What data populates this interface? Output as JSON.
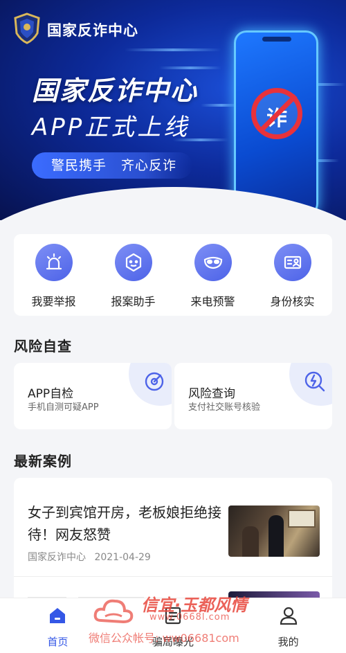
{
  "header": {
    "app_title": "国家反诈中心"
  },
  "banner": {
    "headline": "国家反诈中心",
    "subline": "APP正式上线",
    "slogan": "警民携手 齐心反诈",
    "sign_char": "诈"
  },
  "quick_actions": [
    {
      "label": "我要举报",
      "icon": "alarm-light-icon"
    },
    {
      "label": "报案助手",
      "icon": "hexagon-face-icon"
    },
    {
      "label": "来电预警",
      "icon": "mask-icon"
    },
    {
      "label": "身份核实",
      "icon": "id-card-icon"
    }
  ],
  "risk_section": {
    "title": "风险自查",
    "cards": [
      {
        "title": "APP自检",
        "subtitle": "手机自测可疑APP",
        "icon": "target-scan-icon"
      },
      {
        "title": "风险查询",
        "subtitle": "支付社交账号核验",
        "icon": "lightning-search-icon"
      }
    ]
  },
  "news_section": {
    "title": "最新案例",
    "items": [
      {
        "title": "女子到宾馆开房，老板娘拒绝接待！网友怒赞",
        "source": "国家反诈中心",
        "date": "2021-04-29"
      }
    ]
  },
  "bottom_nav": [
    {
      "label": "首页",
      "icon": "home-icon",
      "active": true
    },
    {
      "label": "骗局曝光",
      "icon": "news-icon",
      "active": false
    },
    {
      "label": "我的",
      "icon": "user-icon",
      "active": false
    }
  ],
  "watermark": {
    "line1": "信宜·玉都风情",
    "line2": "www.0668l.com",
    "line3": "微信公众帐号: ww06681com"
  },
  "colors": {
    "accent": "#3457e6",
    "icon_gradient_start": "#7e8ff5",
    "icon_gradient_end": "#4d63e8",
    "banner_dark": "#07124f"
  }
}
